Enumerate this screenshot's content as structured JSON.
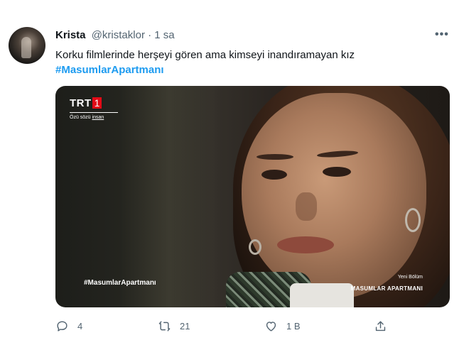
{
  "tweet": {
    "author_name": "Krista",
    "handle": "@kristaklor",
    "separator": "·",
    "time": "1 sa",
    "more": "•••",
    "text": "Korku filmlerinde herşeyi gören ama kimseyi inandıramayan kız",
    "hashtag": "#MasumlarApartmanı"
  },
  "media": {
    "logo_text": "TRT",
    "logo_number": "1",
    "logo_slogan_prefix": "Özü sözü",
    "logo_slogan_word": "insan",
    "overlay_hashtag": "#MasumlarApartmanı",
    "overlay_new_episode": "Yeni Bölüm",
    "overlay_series": "MASUMLAR APARTMANI"
  },
  "actions": {
    "reply": {
      "icon": "reply-icon",
      "count": "4"
    },
    "retweet": {
      "icon": "retweet-icon",
      "count": "21"
    },
    "like": {
      "icon": "heart-icon",
      "count": "1 B"
    },
    "share": {
      "icon": "share-icon",
      "count": ""
    }
  },
  "colors": {
    "link": "#1d9bf0",
    "text": "#0f1419",
    "secondary": "#536471",
    "trt_red": "#e30a17"
  }
}
